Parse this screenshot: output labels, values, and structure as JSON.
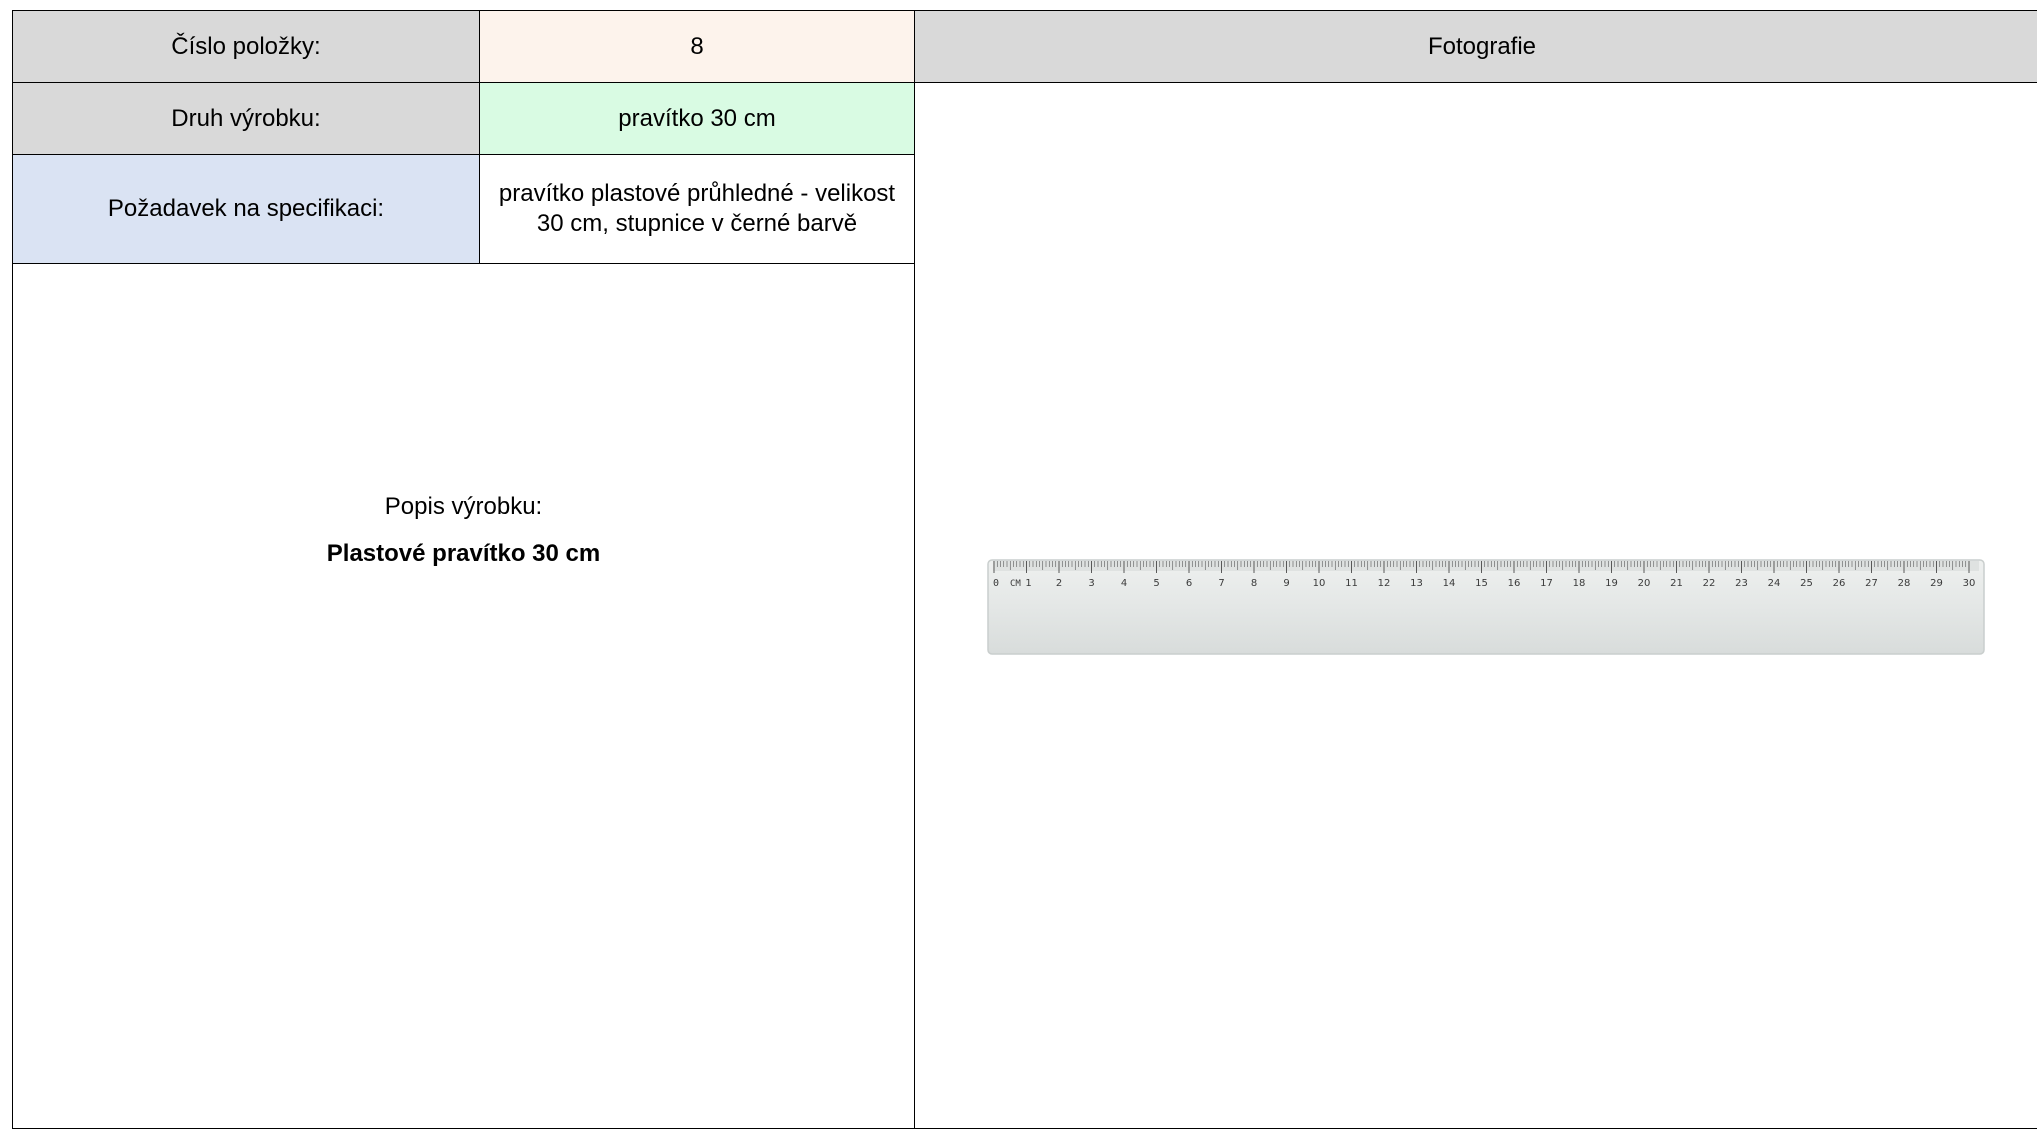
{
  "rows": {
    "item_number": {
      "label": "Číslo položky:",
      "value": "8"
    },
    "product_type": {
      "label": "Druh výrobku:",
      "value": "pravítko 30 cm"
    },
    "spec_requirement": {
      "label": "Požadavek na specifikaci:",
      "value": "pravítko plastové průhledné - velikost 30 cm, stupnice v černé barvě"
    }
  },
  "description": {
    "label": "Popis výrobku:",
    "name": "Plastové pravítko 30 cm"
  },
  "photo": {
    "header": "Fotografie",
    "ruler": {
      "unit_label": "CM",
      "scale": [
        "0",
        "1",
        "2",
        "3",
        "4",
        "5",
        "6",
        "7",
        "8",
        "9",
        "10",
        "11",
        "12",
        "13",
        "14",
        "15",
        "16",
        "17",
        "18",
        "19",
        "20",
        "21",
        "22",
        "23",
        "24",
        "25",
        "26",
        "27",
        "28",
        "29",
        "30"
      ]
    }
  },
  "colors": {
    "label_gray": "#d9d9d9",
    "label_blue": "#dae3f3",
    "value_peach": "#fdf3ec",
    "value_green": "#d9fbe3"
  }
}
